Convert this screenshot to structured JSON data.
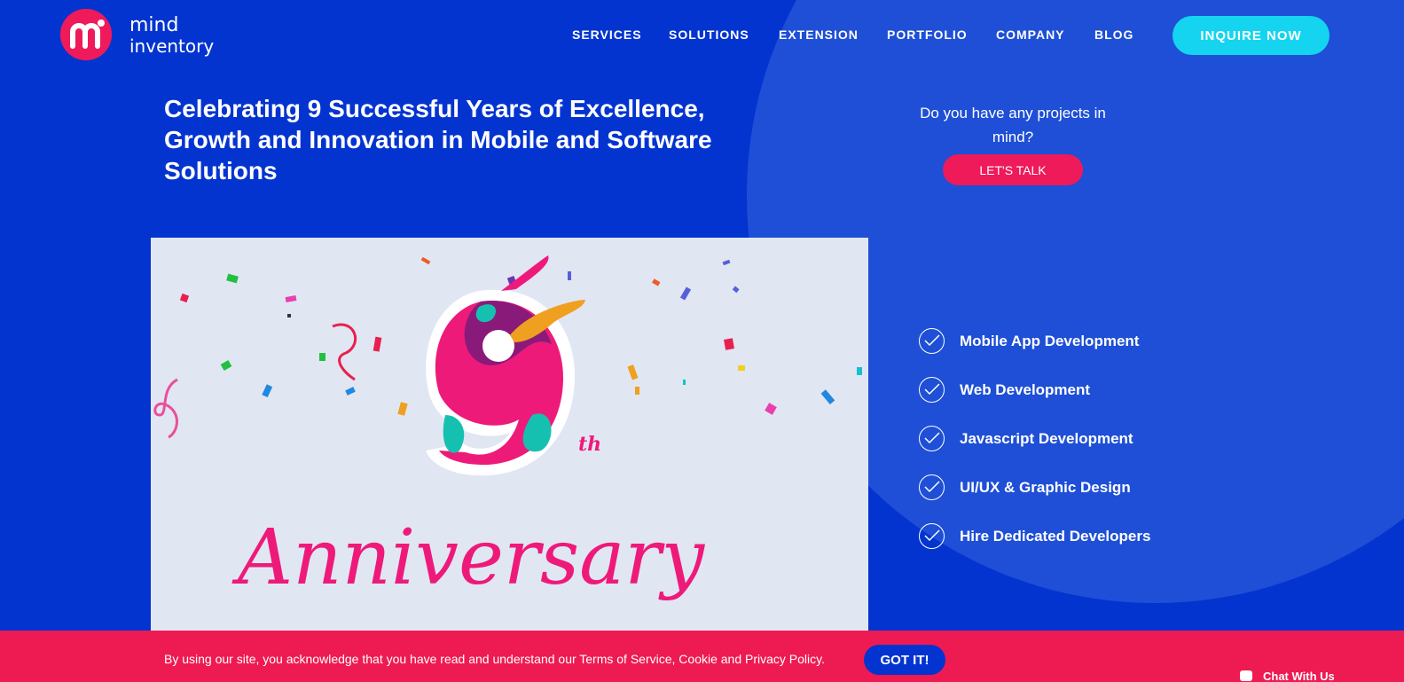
{
  "brand": {
    "logo_line1": "mind",
    "logo_line2": "inventory",
    "accent_pink": "#ee1a5a",
    "accent_cyan": "#14d4f0",
    "primary_blue": "#0434d0"
  },
  "nav": {
    "items": [
      {
        "label": "SERVICES"
      },
      {
        "label": "SOLUTIONS"
      },
      {
        "label": "EXTENSION"
      },
      {
        "label": "PORTFOLIO"
      },
      {
        "label": "COMPANY"
      },
      {
        "label": "BLOG"
      }
    ],
    "cta_label": "INQUIRE NOW"
  },
  "hero": {
    "headline": "Celebrating 9 Successful Years of Excellence, Growth and Innovation in Mobile and Software Solutions",
    "cta_prompt": "Do you have any projects in mind?",
    "cta_button": "LET'S TALK",
    "image": {
      "big_digit": "9",
      "suffix": "th",
      "script_text": "Anniversary"
    }
  },
  "services": [
    {
      "label": "Mobile App Development",
      "icon": "check-circle-icon"
    },
    {
      "label": "Web Development",
      "icon": "check-circle-icon"
    },
    {
      "label": "Javascript Development",
      "icon": "check-circle-icon"
    },
    {
      "label": "UI/UX & Graphic Design",
      "icon": "check-circle-icon"
    },
    {
      "label": "Hire Dedicated Developers",
      "icon": "check-circle-icon"
    }
  ],
  "cookie_bar": {
    "text": "By using our site, you acknowledge that you have read and understand our Terms of Service, Cookie and Privacy Policy.",
    "button": "GOT IT!"
  },
  "chat_widget": {
    "label": "Chat With Us"
  }
}
